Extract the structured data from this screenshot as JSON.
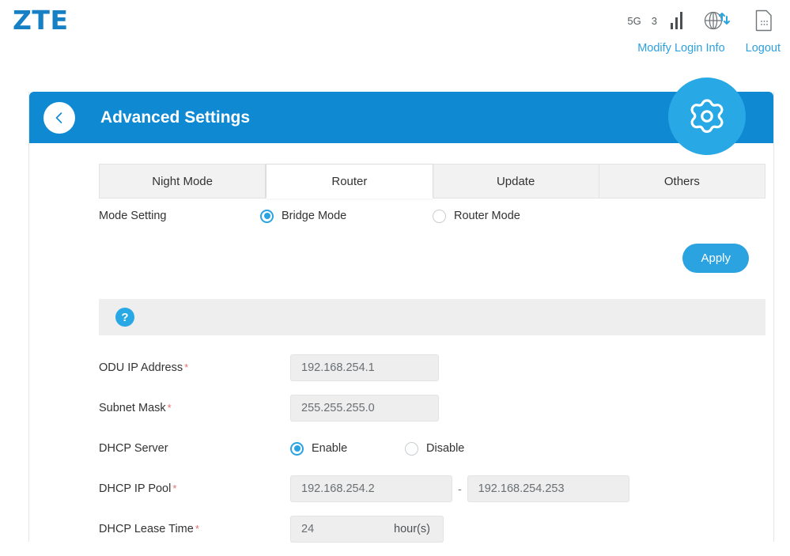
{
  "brand": {
    "logo": "ZTE",
    "accent": "#1580c4",
    "header_blue": "#1089d3",
    "badge_blue": "#29a8e6"
  },
  "topbar": {
    "network_type": "5G",
    "signal_count": "3",
    "icons": {
      "bars": "signal-bars-icon",
      "globe": "globe-data-icon",
      "sim": "sim-card-icon"
    },
    "links": [
      {
        "label": "Modify Login Info"
      },
      {
        "label": "Logout"
      }
    ]
  },
  "card": {
    "title": "Advanced Settings",
    "back_icon": "chevron-left-icon",
    "gear_icon": "gear-icon"
  },
  "tabs": [
    {
      "label": "Night Mode",
      "active": false
    },
    {
      "label": "Router",
      "active": true
    },
    {
      "label": "Update",
      "active": false
    },
    {
      "label": "Others",
      "active": false
    }
  ],
  "mode_setting": {
    "label": "Mode Setting",
    "options": [
      {
        "label": "Bridge Mode",
        "selected": true
      },
      {
        "label": "Router Mode",
        "selected": false
      }
    ]
  },
  "apply": {
    "label": "Apply"
  },
  "help": {
    "icon_glyph": "?"
  },
  "fields": {
    "odu_ip": {
      "label": "ODU IP Address",
      "required": "*",
      "value": "192.168.254.1"
    },
    "subnet_mask": {
      "label": "Subnet Mask",
      "required": "*",
      "value": "255.255.255.0"
    },
    "dhcp_server": {
      "label": "DHCP Server",
      "options": [
        {
          "label": "Enable",
          "selected": true
        },
        {
          "label": "Disable",
          "selected": false
        }
      ]
    },
    "dhcp_pool": {
      "label": "DHCP IP Pool",
      "required": "*",
      "start": "192.168.254.2",
      "separator": "-",
      "end": "192.168.254.253"
    },
    "dhcp_lease": {
      "label": "DHCP Lease Time",
      "required": "*",
      "value": "24",
      "unit": "hour(s)"
    }
  }
}
